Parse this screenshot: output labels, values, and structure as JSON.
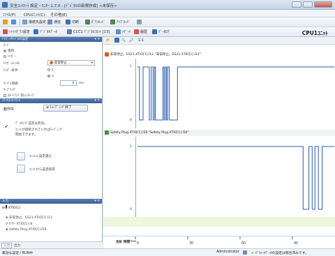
{
  "window": {
    "title": "安全ｺﾝﾄﾛｰﾗ 設定・ﾓﾆﾀｰ 1.7.0 - [ﾃﾞｼﾞﾀﾙの新規作成] <未保存>"
  },
  "menu": [
    "ﾌｧｲﾙ(F)",
    "CPUﾕﾆｯﾄ(C)",
    "その他(E)"
  ],
  "toolbar1": [
    {
      "label": "",
      "icon": "new-icon",
      "color": "#e8a020"
    },
    {
      "label": "",
      "icon": "settings-icon",
      "color": "#5a8fd0"
    },
    {
      "label": "接続先設定",
      "icon": "connect-icon",
      "color": "#7aa0c8"
    },
    {
      "label": "通信",
      "icon": "comm-icon",
      "color": "#6d8fb8"
    },
    {
      "label": "切断",
      "icon": "disconnect-icon",
      "color": "#3b6fb5"
    },
    {
      "label": "ﾀﾞｳﾝﾛｰﾄﾞ",
      "icon": "download-icon",
      "color": "#4a8a4a"
    },
    {
      "label": "ｱｯﾌﾟﾛｰﾄﾞ",
      "icon": "upload-icon",
      "color": "#4a8a4a"
    },
    {
      "label": "",
      "icon": "menu-icon",
      "color": "#8899aa"
    }
  ],
  "toolbar2": [
    {
      "label": "ｼｬｯﾄﾀﾞｳﾝ設定",
      "icon": "shutdown-icon",
      "color": "#d9534f"
    },
    {
      "label": "ﾃﾞｼﾞﾀﾙﾃﾞｰﾀ",
      "icon": "digital-icon",
      "color": "#3b6fb5"
    },
    {
      "label": "CCC1 ﾃﾞｼﾞﾀﾙﾌﾛﾝﾄ [13]",
      "icon": "front-icon",
      "color": "#5a7fb4"
    },
    {
      "label": "ﾒﾃﾞｰﾄ",
      "icon": "meter-icon",
      "color": "#5a8fd0"
    },
    {
      "label": "履歴",
      "icon": "history-icon",
      "color": "#d9534f"
    },
    {
      "label": "ﾃﾞｰﾀﾛｸﾞ",
      "icon": "datalog-icon",
      "color": "#3b6fb5"
    }
  ],
  "cpu_label": "CPU1ﾕﾆｯﾄ",
  "left": {
    "trigger_header": "ﾄﾘｶﾞｰ/ｻﾝﾌﾟﾙの設定",
    "mode_label": "ﾓｰﾄﾞ",
    "mode_options": [
      "連続",
      "ﾄﾘｶﾞｰ"
    ],
    "trigger_channel_label": "ﾄﾘｶﾞｰﾁｬﾝﾈﾙ",
    "trigger_channel_value": "非常停止...",
    "trigger_cond_label": "ﾄﾘｶﾞｰ条件",
    "trigger_cond_options": [
      "1",
      "0"
    ],
    "sample_label": "ｻﾝﾌﾟﾙ周期",
    "sample_unit": "ms",
    "recording_label": "ｻﾝﾌﾟﾘﾝｸﾞ",
    "option_label": "ｽﾀｰﾄｱｯﾌﾟ前にｽﾄｯﾌﾟ",
    "status_header": "ｽﾃｰﾀｽ/ｺﾝﾄﾛｰﾙ",
    "state_text": "動作中",
    "stop_button": "ﾚｺｰﾃﾞｨﾝｸﾞ終了",
    "message_line1": "ﾃﾞｰﾀﾛｰﾀﾞ設定は有効。",
    "message_line2": "ﾕﾆｯﾄが接続されていればﾛｰﾃﾞｨﾝｸﾞ",
    "message_line3": "開始できます。",
    "write_button": "ﾕﾆｯﾄに設定書込",
    "read_button": "ﾕﾆｯﾄから設定取得",
    "io_header": "入力",
    "tree_root": "XTIO[1]",
    "tree_items": [
      "非常停止。ES21.XTIO[1].I12",
      "ｾﾝｻｰ XTIO[1].I4",
      "Safety Plug.XTIO[1].I56"
    ],
    "tabs": [
      "入力",
      "出力"
    ]
  },
  "right": {
    "toolbar_label": "1:1",
    "signal1": "非常停止。ES21.XTIO[1].I12 \"非常停止。ES21.XTIO[1].I12\"",
    "signal2": "Safety Plug.XTIO[1].I56 \"Safety Plug.XTIO[1].I56\"",
    "axis_label": "合計 時間",
    "axis_unit": "tsec",
    "y_one": "1",
    "y_zero": "0",
    "x_ticks": [
      "0",
      "30",
      "60",
      "90",
      "12"
    ]
  },
  "chart_data": [
    {
      "type": "line",
      "title": "非常停止。ES21.XTIO[1].I12",
      "x": [
        0,
        1.2,
        1.2,
        3.4,
        3.4,
        7.2,
        7.2,
        8.3,
        8.3,
        9.5,
        9.5,
        10.3,
        10.3,
        11.0,
        11.0,
        15.5,
        15.5,
        16.2,
        16.2,
        17.0,
        17.0,
        17.7,
        17.7,
        18.4,
        18.4,
        19.4,
        19.4,
        24.4,
        24.4,
        120
      ],
      "y": [
        1,
        1,
        0,
        0,
        1,
        1,
        0,
        0,
        1,
        1,
        0,
        0,
        1,
        1,
        0,
        0,
        1,
        1,
        0,
        0,
        1,
        1,
        0,
        0,
        1,
        1,
        0,
        0,
        1,
        1
      ],
      "ylim": [
        0,
        1
      ]
    },
    {
      "type": "line",
      "title": "Safety Plug.XTIO[1].I56",
      "x": [
        0,
        101,
        101,
        104.5,
        104.5,
        106.5,
        106.5,
        108.2,
        108.2,
        110.3,
        110.3,
        112.6,
        112.6,
        120
      ],
      "y": [
        1,
        1,
        0,
        0,
        1,
        1,
        0,
        0,
        1,
        1,
        0,
        0,
        1,
        1
      ],
      "ylim": [
        0,
        1
      ]
    }
  ],
  "status": {
    "left": "無効な設定 / RUN中",
    "user": "Administrator",
    "msg": "ﾊﾟﾗﾒｰﾀﾃﾞｰﾀの設定は照合済みです。"
  }
}
